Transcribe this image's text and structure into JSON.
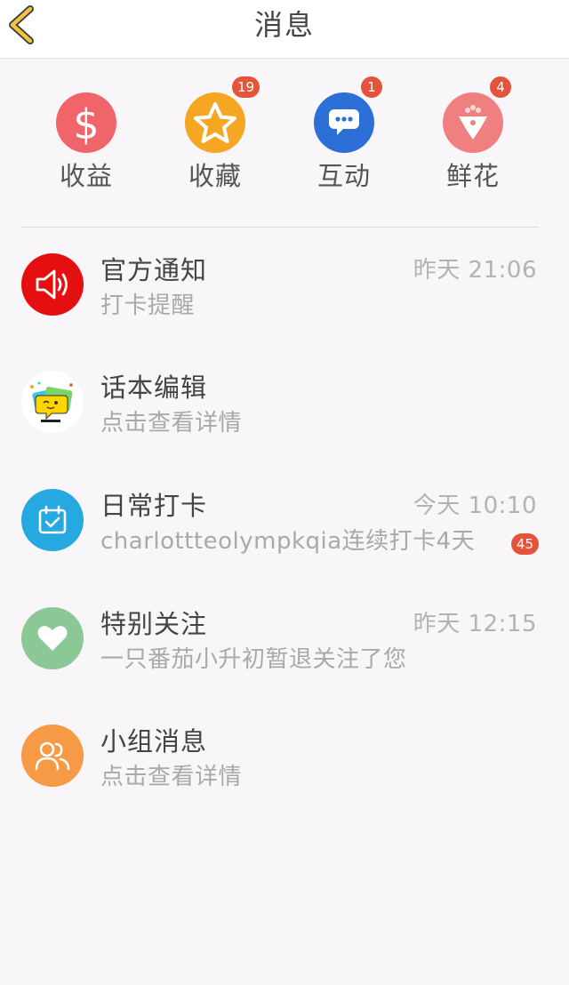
{
  "header": {
    "title": "消息"
  },
  "categories": [
    {
      "label": "收益",
      "icon": "dollar-icon",
      "color": "#f0656a",
      "badge": ""
    },
    {
      "label": "收藏",
      "icon": "star-icon",
      "color": "#f5a623",
      "badge": "19"
    },
    {
      "label": "互动",
      "icon": "chat-bubble-icon",
      "color": "#2c6fd6",
      "badge": "1"
    },
    {
      "label": "鲜花",
      "icon": "flower-icon",
      "color": "#f07f80",
      "badge": "4"
    }
  ],
  "messages": [
    {
      "title": "官方通知",
      "subtitle": "打卡提醒",
      "time": "昨天 21:06",
      "badge": "",
      "icon": "megaphone-icon",
      "color": "#e60f0f"
    },
    {
      "title": "话本编辑",
      "subtitle": "点击查看详情",
      "time": "",
      "badge": "",
      "icon": "editor-avatar",
      "color": "#ffffff"
    },
    {
      "title": "日常打卡",
      "subtitle": "charlottteolympkqia连续打卡4天",
      "time": "今天 10:10",
      "badge": "45",
      "icon": "calendar-check-icon",
      "color": "#26a9e0"
    },
    {
      "title": "特别关注",
      "subtitle": "一只番茄小升初暂退关注了您",
      "time": "昨天 12:15",
      "badge": "",
      "icon": "heart-icon",
      "color": "#8cc895"
    },
    {
      "title": "小组消息",
      "subtitle": "点击查看详情",
      "time": "",
      "badge": "",
      "icon": "group-icon",
      "color": "#f69a45"
    }
  ]
}
